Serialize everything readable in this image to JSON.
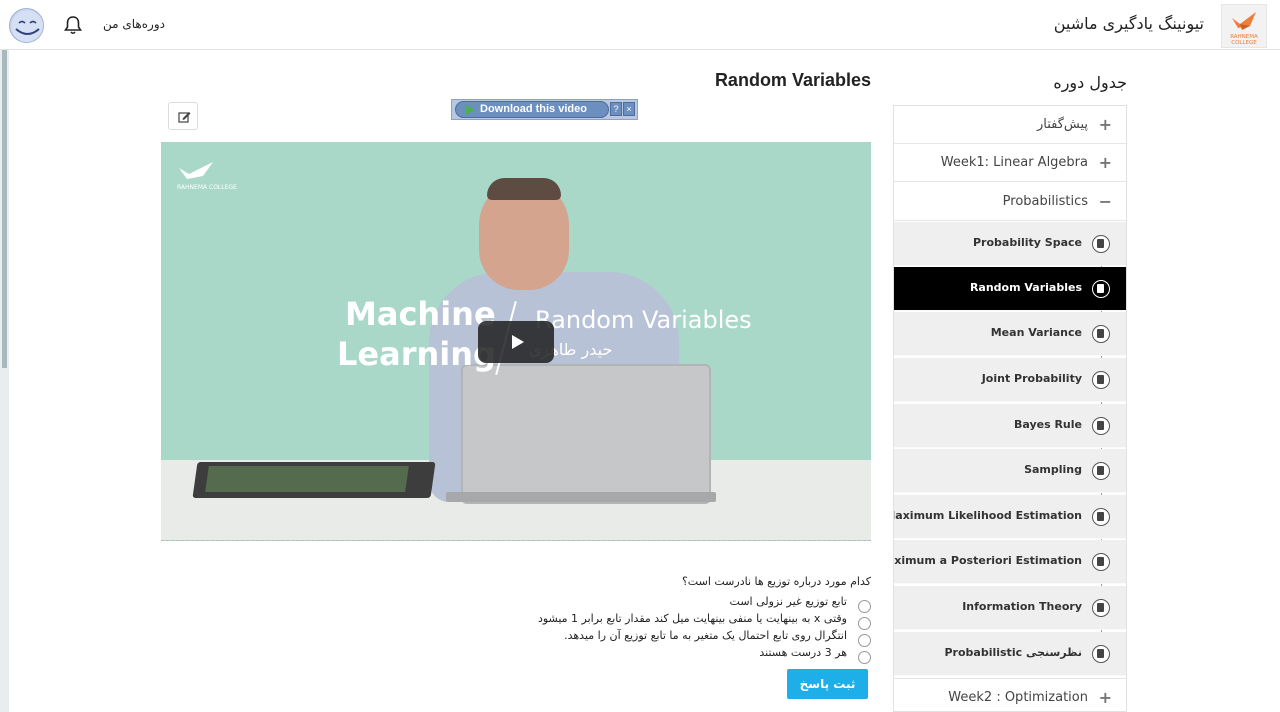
{
  "header": {
    "app_title": "تیونینگ یادگیری ماشین",
    "logo_text": "RAHNEMA COLLEGE",
    "my_courses": "دوره‌های من",
    "icons": {
      "bell": "bell-icon",
      "avatar": "avatar"
    }
  },
  "sidebar": {
    "title": "جدول دوره",
    "sections": [
      {
        "label": "پیش‌گفتار",
        "toggle": "+"
      },
      {
        "label": "Week1: Linear Algebra",
        "toggle": "+"
      },
      {
        "label": "Probabilistics",
        "toggle": "−"
      }
    ],
    "items": [
      {
        "label": "Probability Space",
        "active": false
      },
      {
        "label": "Random Variables",
        "active": true
      },
      {
        "label": "Mean Variance",
        "active": false
      },
      {
        "label": "Joint Probability",
        "active": false
      },
      {
        "label": "Bayes Rule",
        "active": false
      },
      {
        "label": "Sampling",
        "active": false
      },
      {
        "label": "Maximum Likelihood Estimation",
        "active": false
      },
      {
        "label": "Maximum a Posteriori Estimation",
        "active": false
      },
      {
        "label": "Information Theory",
        "active": false
      },
      {
        "label": "Probabilistic نظرسنجی",
        "active": false
      }
    ],
    "last_section": {
      "label": "Week2 : Optimization",
      "toggle": "+"
    }
  },
  "main": {
    "lesson_title": "Random Variables",
    "download_label": "Download this video",
    "download_help": "?",
    "download_close": "×",
    "video": {
      "logo_text": "RAHNEMA COLLEGE",
      "title_line1": "Machine",
      "title_line2": "Learning",
      "subtitle": "Random Variables",
      "author": "حیدر طاهری"
    }
  },
  "quiz": {
    "question": "کدام مورد درباره توزیع ها نادرست است؟",
    "options": [
      "تابع توزیع غیر نزولی است",
      "وقتی x به بینهایت یا منفی بینهایت میل کند مقدار تابع برابر 1 میشود",
      "انتگرال روی تابع احتمال یک متغیر به ما تابع توزیع آن را میدهد.",
      "هر 3 درست هستند"
    ],
    "submit_label": "ثبت پاسخ"
  },
  "colors": {
    "accent": "#1eaee8",
    "active_item": "#000000",
    "video_bg": "#a9d8c9"
  }
}
